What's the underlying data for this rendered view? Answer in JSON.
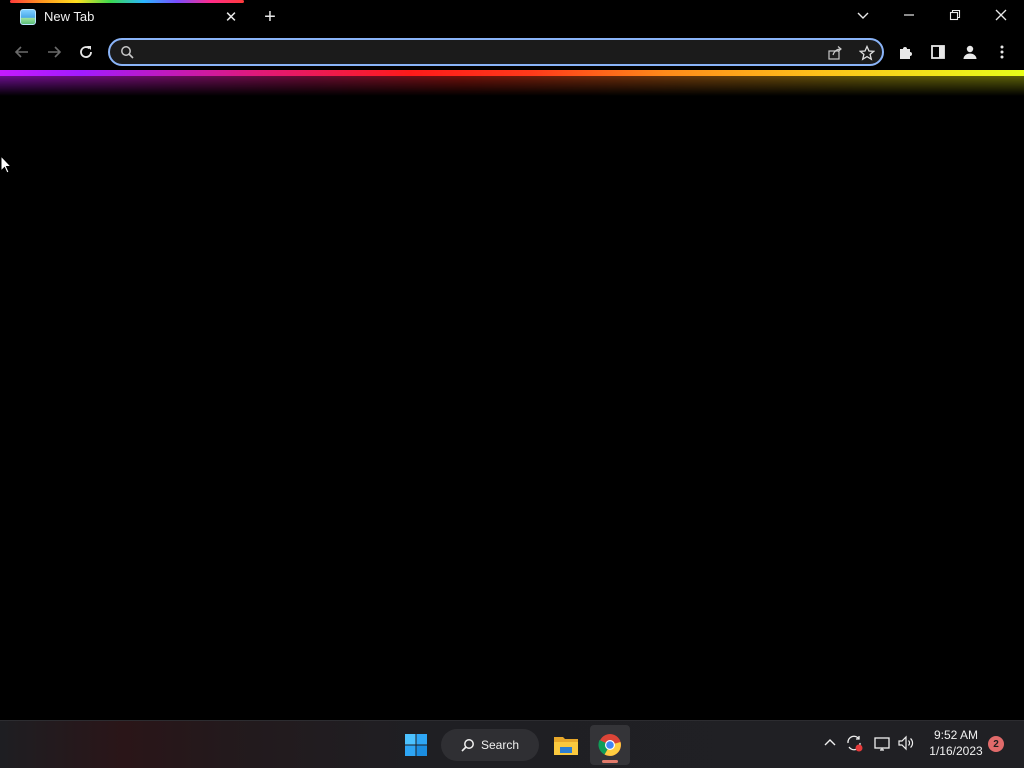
{
  "browser": {
    "tab": {
      "title": "New Tab",
      "close_glyph": "✕"
    },
    "new_tab_glyph": "+",
    "omnibox": {
      "value": "",
      "placeholder": ""
    },
    "colors": {
      "omnibox_border": "#8ab4f8",
      "background": "#000000"
    }
  },
  "taskbar": {
    "search_label": "Search",
    "clock": {
      "time": "9:52 AM",
      "date": "1/16/2023"
    },
    "notifications": "2",
    "active_indicator_color": "#e27b6b"
  }
}
